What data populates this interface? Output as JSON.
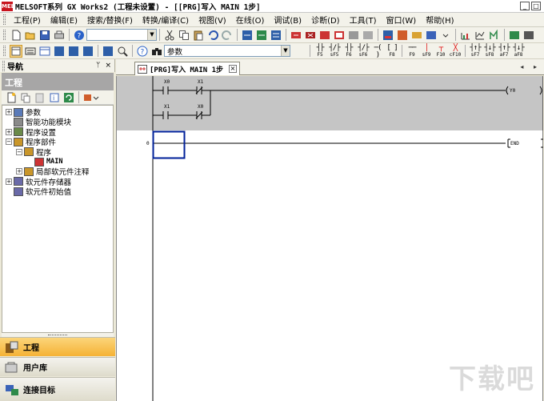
{
  "window": {
    "logo": "MEL",
    "title": "MELSOFT系列 GX Works2 (工程未设置) - [[PRG]写入 MAIN 1步]",
    "buttons": [
      "_",
      "□",
      "×"
    ]
  },
  "menu": [
    "工程(P)",
    "编辑(E)",
    "搜索/替换(F)",
    "转换/编译(C)",
    "视图(V)",
    "在线(O)",
    "调试(B)",
    "诊断(D)",
    "工具(T)",
    "窗口(W)",
    "帮助(H)"
  ],
  "toolbar2": {
    "search_combo_value": "参数"
  },
  "ladder_toolbar": [
    {
      "sym": "┤├",
      "key": "F5",
      "red": false
    },
    {
      "sym": "┤/├",
      "key": "sF5",
      "red": false
    },
    {
      "sym": "┤├",
      "key": "F6",
      "red": false
    },
    {
      "sym": "┤/├",
      "key": "sF6",
      "red": false
    },
    {
      "sym": "─( )",
      "key": "F7",
      "red": false
    },
    {
      "sym": "[ ]",
      "key": "F8",
      "red": false
    },
    {
      "sym": "──",
      "key": "F9",
      "red": false
    },
    {
      "sym": "│",
      "key": "sF9",
      "red": true
    },
    {
      "sym": "┬",
      "key": "F10",
      "red": true
    },
    {
      "sym": "╳",
      "key": "cF10",
      "red": true
    },
    {
      "sym": "┤↑├",
      "key": "sF7",
      "red": false
    },
    {
      "sym": "┤↓├",
      "key": "sF8",
      "red": false
    },
    {
      "sym": "┤↑├",
      "key": "aF7",
      "red": false
    },
    {
      "sym": "┤↓├",
      "key": "aF8",
      "red": false
    }
  ],
  "navigation": {
    "header": "导航",
    "pin": "ᛘ",
    "close": "×",
    "section": "工程",
    "tree": [
      {
        "label": "参数",
        "level": 0,
        "expander": "+"
      },
      {
        "label": "智能功能模块",
        "level": 0,
        "expander": ""
      },
      {
        "label": "程序设置",
        "level": 0,
        "expander": "+"
      },
      {
        "label": "程序部件",
        "level": 0,
        "expander": "−"
      },
      {
        "label": "程序",
        "level": 1,
        "expander": "−"
      },
      {
        "label": "MAIN",
        "level": 2,
        "expander": ""
      },
      {
        "label": "局部软元件注释",
        "level": 1,
        "expander": "+"
      },
      {
        "label": "软元件存储器",
        "level": 0,
        "expander": "+"
      },
      {
        "label": "软元件初始值",
        "level": 0,
        "expander": ""
      }
    ],
    "bottom_tabs": [
      "工程",
      "用户库",
      "连接目标"
    ]
  },
  "document_tab": {
    "label": "[PRG]写入 MAIN 1步",
    "close": "×",
    "scroll_arrows": "◂ ▸"
  },
  "ladder": {
    "rung1": {
      "contacts_row1": [
        "X0",
        "X1"
      ],
      "contacts_row2": [
        "X1",
        "X0"
      ],
      "coil": "Y0"
    },
    "rung2": {
      "step": "0",
      "instruction": "END"
    }
  },
  "watermark": "下载吧",
  "colors": {
    "rung_shade": "#c5c5c5",
    "cursor": "#00209a",
    "active_tab": "#f5b236"
  }
}
